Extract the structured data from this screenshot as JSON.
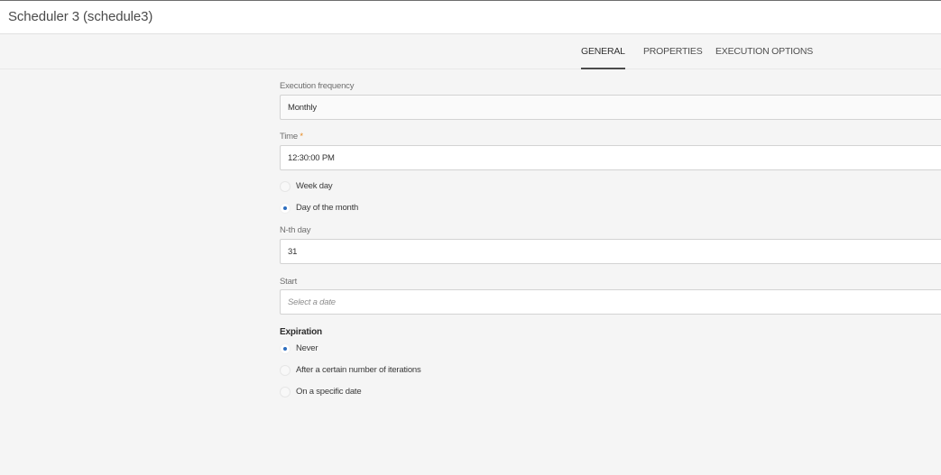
{
  "window": {
    "title": "Scheduler 3 (schedule3)"
  },
  "tabs": [
    {
      "label": "GENERAL",
      "active": true
    },
    {
      "label": "PROPERTIES",
      "active": false
    },
    {
      "label": "EXECUTION OPTIONS",
      "active": false
    }
  ],
  "form": {
    "execution_frequency": {
      "label": "Execution frequency",
      "value": "Monthly"
    },
    "time": {
      "label": "Time",
      "required_marker": "*",
      "value": "12:30:00 PM"
    },
    "day_mode": {
      "options": [
        {
          "label": "Week day",
          "checked": false
        },
        {
          "label": "Day of the month",
          "checked": true
        }
      ]
    },
    "nth_day": {
      "label": "N-th day",
      "value": "31"
    },
    "start": {
      "label": "Start",
      "placeholder": "Select a date"
    },
    "expiration": {
      "label": "Expiration",
      "options": [
        {
          "label": "Never",
          "checked": true
        },
        {
          "label": "After a certain number of iterations",
          "checked": false
        },
        {
          "label": "On a specific date",
          "checked": false
        }
      ]
    }
  },
  "colors": {
    "accent": "#2d6ebf",
    "required": "#e68619",
    "background": "#f5f5f5",
    "surface": "#ffffff"
  }
}
